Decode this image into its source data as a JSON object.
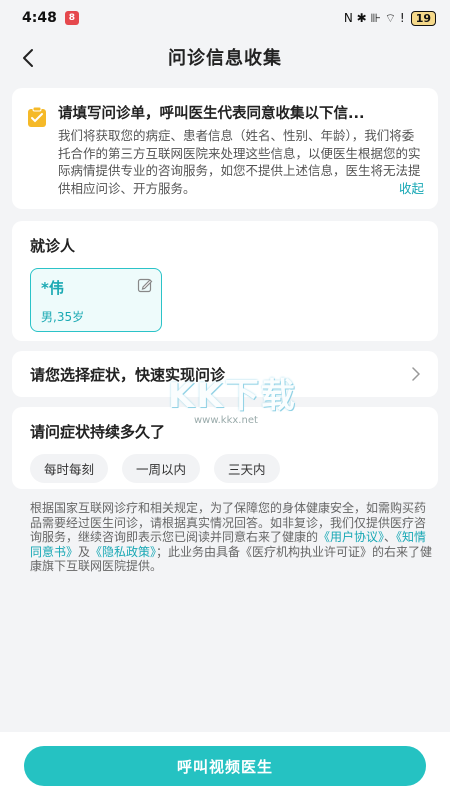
{
  "status_bar": {
    "time": "4:48",
    "notif_badge": "8",
    "signal_text": "N ✱ ⊪ ⌔ ! ",
    "battery": "19"
  },
  "header": {
    "title": "问诊信息收集"
  },
  "notice": {
    "title": "请填写问诊单，呼叫医生代表同意收集以下信...",
    "body": "我们将获取您的病症、患者信息（姓名、性别、年龄），我们将委托合作的第三方互联网医院来处理这些信息，以便医生根据您的实际病情提供专业的咨询服务，如您不提供上述信息，医生将无法提供相应问诊、开方服务。",
    "collapse": "收起"
  },
  "patient": {
    "section_title": "就诊人",
    "name": "*伟",
    "meta": "男,35岁"
  },
  "symptom": {
    "label": "请您选择症状，快速实现问诊"
  },
  "duration": {
    "title": "请问症状持续多久了",
    "options": [
      "每时每刻",
      "一周以内",
      "三天内"
    ]
  },
  "legal": {
    "part1": "根据国家互联网诊疗和相关规定，为了保障您的身体健康安全，如需购买药品需要经过医生问诊，请根据真实情况回答。如非复诊，我们仅提供医疗咨询服务，继续咨询即表示您已阅读并同意右来了健康的",
    "link1": "《用户协议》",
    "sep1": "、",
    "link2": "《知情同意书》",
    "sep2": "及",
    "link3": "《隐私政策》",
    "part2": "；此业务由具备《医疗机构执业许可证》的右来了健康旗下互联网医院提供。"
  },
  "watermark": {
    "main": "KK下载",
    "url": "www.kkx.net"
  },
  "bottom": {
    "call_button": "呼叫视频医生"
  },
  "colors": {
    "accent": "#25c2c2",
    "link": "#18a8b5",
    "background": "#f3f4f6"
  }
}
